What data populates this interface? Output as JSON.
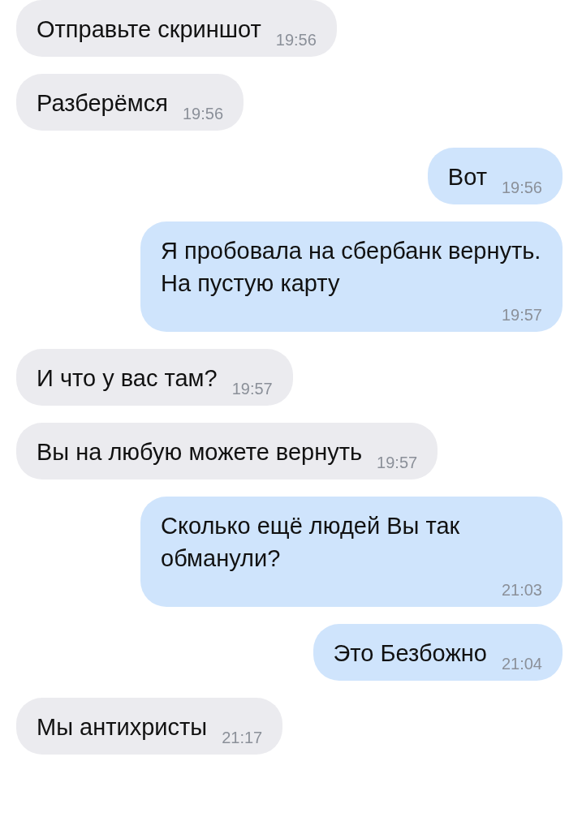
{
  "messages": [
    {
      "kind": "incoming",
      "text": "Отправьте скриншот",
      "time": "19:56"
    },
    {
      "kind": "incoming",
      "text": "Разберёмся",
      "time": "19:56"
    },
    {
      "kind": "outgoing",
      "text": "Вот",
      "time": "19:56"
    },
    {
      "kind": "outgoing",
      "text": "Я пробовала на сбербанк вернуть. На пустую карту",
      "time": "19:57"
    },
    {
      "kind": "incoming",
      "text": "И что у вас там?",
      "time": "19:57"
    },
    {
      "kind": "incoming",
      "text": "Вы на любую можете вернуть",
      "time": "19:57"
    },
    {
      "kind": "outgoing",
      "text": "Сколько ещё людей Вы так обманули?",
      "time": "21:03"
    },
    {
      "kind": "outgoing",
      "text": "Это Безбожно",
      "time": "21:04"
    },
    {
      "kind": "incoming",
      "text": "Мы антихристы",
      "time": "21:17"
    }
  ]
}
